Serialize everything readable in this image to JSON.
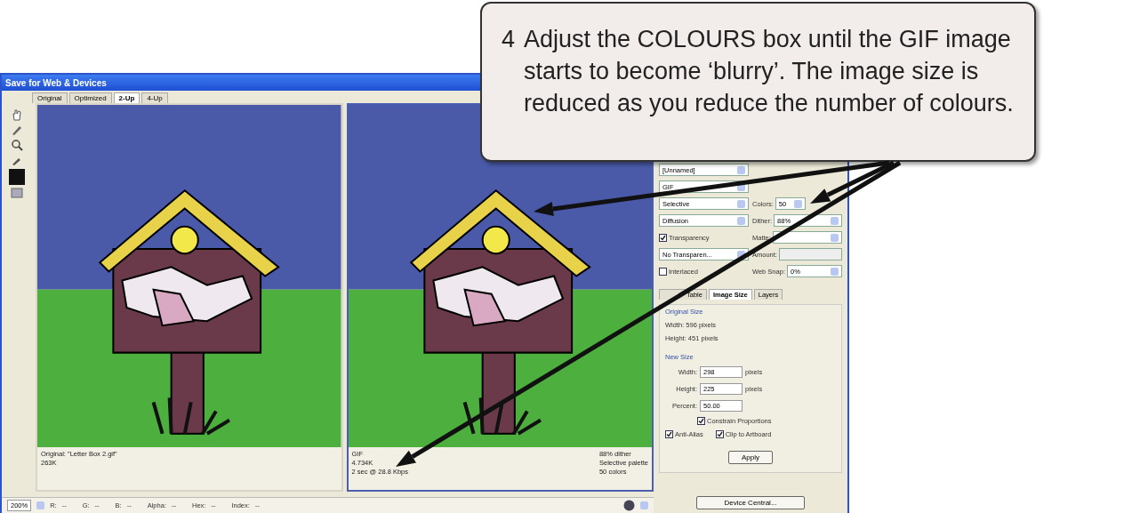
{
  "window": {
    "title": "Save for Web & Devices"
  },
  "view_tabs": [
    {
      "label": "Original",
      "selected": false
    },
    {
      "label": "Optimized",
      "selected": false
    },
    {
      "label": "2-Up",
      "selected": true
    },
    {
      "label": "4-Up",
      "selected": false
    }
  ],
  "panes": [
    {
      "selected": false,
      "info_left": [
        "Original: \"Letter Box 2.gif\"",
        "263K"
      ]
    },
    {
      "selected": true,
      "info_left": [
        "GIF",
        "4.734K",
        "2 sec @ 28.8 Kbps"
      ],
      "info_right": [
        "88% dither",
        "Selective palette",
        "50 colors"
      ]
    }
  ],
  "settings": {
    "preset": "[Unnamed]",
    "format": "GIF",
    "reduction": "Selective",
    "colors_label": "Colors:",
    "colors": "50",
    "dither_method": "Diffusion",
    "dither_label": "Dither:",
    "dither": "88%",
    "transparency": {
      "label": "Transparency",
      "checked": true
    },
    "matte_label": "Matte:",
    "transparency_dither": "No Transparen...",
    "amount_label": "Amount:",
    "interlaced": {
      "label": "Interlaced",
      "checked": false
    },
    "web_snap_label": "Web Snap:",
    "web_snap": "0%"
  },
  "panel_tabs": [
    {
      "label": "Table",
      "selected": false
    },
    {
      "label": "Image Size",
      "selected": true
    },
    {
      "label": "Layers",
      "selected": false
    }
  ],
  "original_size": {
    "title": "Original Size",
    "width": "Width: 596 pixels",
    "height": "Height: 451 pixels"
  },
  "new_size": {
    "title": "New Size",
    "fields": [
      {
        "label": "Width:",
        "value": "298",
        "unit": "pixels"
      },
      {
        "label": "Height:",
        "value": "225",
        "unit": "pixels"
      },
      {
        "label": "Percent:",
        "value": "50.00"
      }
    ]
  },
  "options": [
    {
      "label": "Constrain Proportions",
      "checked": true
    },
    {
      "label": "Anti-Alias",
      "checked": true
    },
    {
      "label": "Clip to Artboard",
      "checked": true
    }
  ],
  "apply": "Apply",
  "device_central": "Device Central...",
  "status_bar": {
    "zoom": "200%",
    "readouts": [
      {
        "label": "R:",
        "value": "--"
      },
      {
        "label": "G:",
        "value": "--"
      },
      {
        "label": "B:",
        "value": "--"
      },
      {
        "label": "Alpha:",
        "value": "--"
      },
      {
        "label": "Hex:",
        "value": "--"
      },
      {
        "label": "Index:",
        "value": "--"
      }
    ]
  },
  "callout": {
    "step": "4",
    "text": "Adjust the COLOURS box until the GIF image starts to become ‘blurry’. The image size is reduced as you reduce the number of colours."
  }
}
